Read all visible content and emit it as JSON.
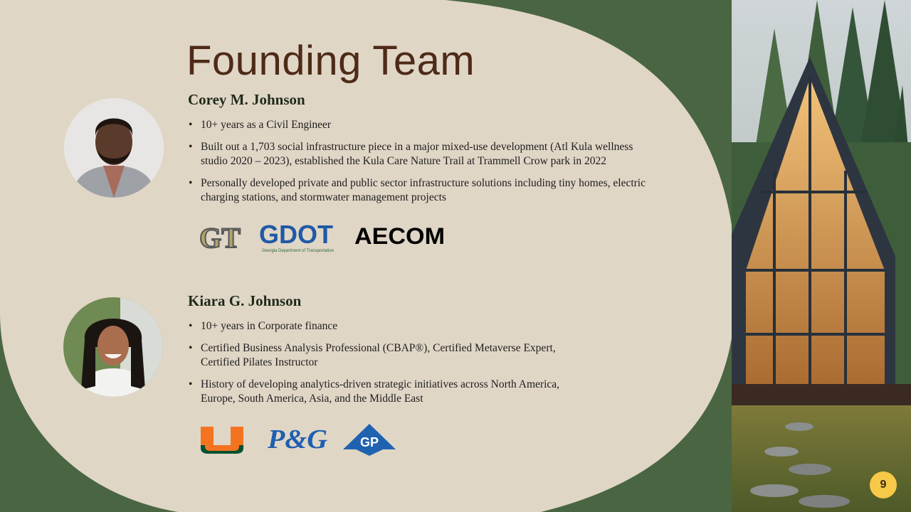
{
  "slide": {
    "title": "Founding Team",
    "page_number": "9",
    "colors": {
      "background_green": "#4a6542",
      "panel_beige": "#e0d6c6",
      "title_brown": "#4e2a17",
      "badge_yellow": "#f7c948"
    }
  },
  "members": [
    {
      "name": "Corey M. Johnson",
      "bullets": [
        "10+ years as a Civil Engineer",
        "Built out a 1,703 social infrastructure piece in a major mixed-use development (Atl Kula wellness studio 2020 – 2023), established the Kula Care Nature Trail at Trammell Crow park in 2022",
        "Personally developed private and public sector infrastructure solutions including tiny homes, electric charging stations, and stormwater management projects"
      ],
      "logos": {
        "gt": "GT",
        "gdot": "GDOT",
        "gdot_sub": "Georgia Department of Transportation",
        "aecom": "AECOM"
      }
    },
    {
      "name": "Kiara G. Johnson",
      "bullets": [
        "10+ years in Corporate finance",
        "Certified Business Analysis Professional (CBAP®), Certified Metaverse Expert, Certified Pilates Instructor",
        "History of developing analytics-driven strategic initiatives across North America, Europe, South America, Asia, and the Middle East"
      ],
      "logos": {
        "um": "U",
        "pg": "P&G",
        "gp": "GP"
      }
    }
  ],
  "icons": [
    "person-photo-icon",
    "cabin-photo-icon"
  ]
}
